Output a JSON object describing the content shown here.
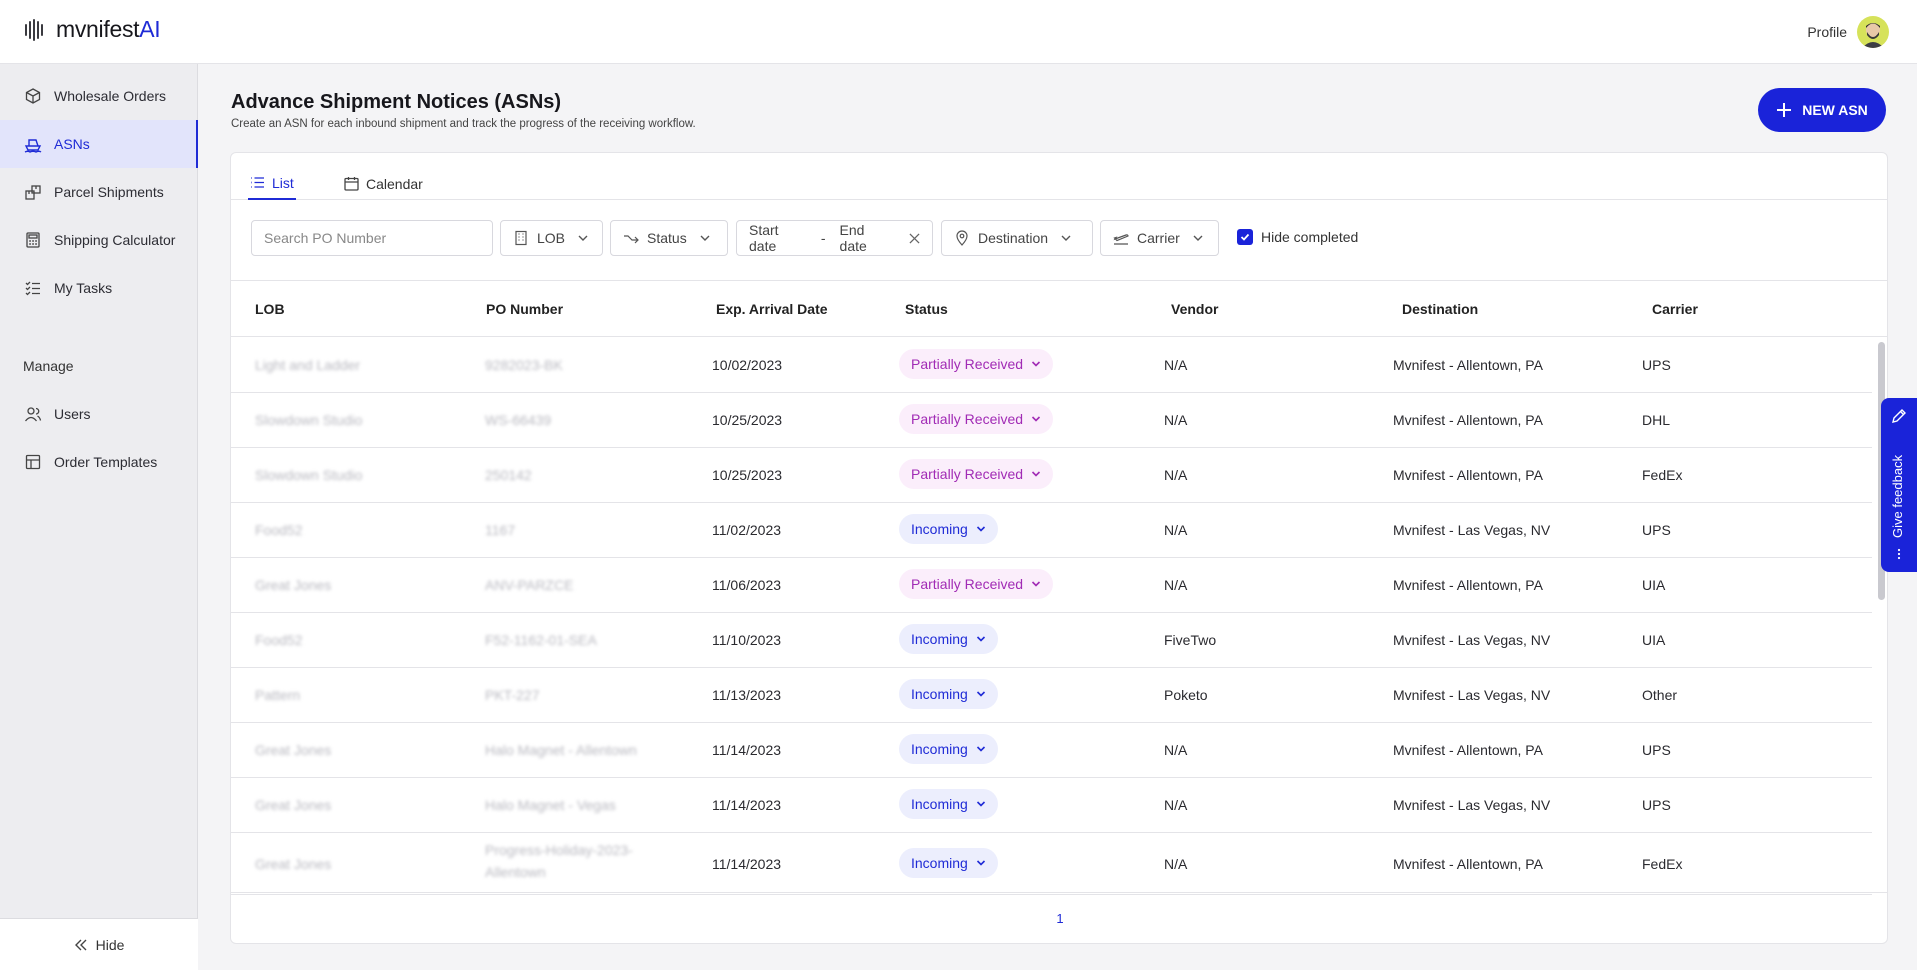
{
  "app": {
    "logo_main": "mvnifest",
    "logo_ai": "AI",
    "profile_label": "Profile"
  },
  "sidebar": {
    "items": [
      {
        "label": "Wholesale Orders",
        "icon": "box-icon"
      },
      {
        "label": "ASNs",
        "icon": "ship-icon",
        "active": true
      },
      {
        "label": "Parcel Shipments",
        "icon": "parcel-icon"
      },
      {
        "label": "Shipping Calculator",
        "icon": "calculator-icon"
      },
      {
        "label": "My Tasks",
        "icon": "tasks-icon"
      }
    ],
    "manage_label": "Manage",
    "manage_items": [
      {
        "label": "Users",
        "icon": "users-icon"
      },
      {
        "label": "Order Templates",
        "icon": "template-icon"
      }
    ],
    "hide_label": "Hide"
  },
  "header": {
    "title": "Advance Shipment Notices (ASNs)",
    "subtitle": "Create an ASN for each inbound shipment and track the progress of the receiving workflow.",
    "new_button": "NEW ASN"
  },
  "tabs": [
    {
      "label": "List",
      "active": true
    },
    {
      "label": "Calendar"
    }
  ],
  "filters": {
    "search_placeholder": "Search PO Number",
    "lob": "LOB",
    "status": "Status",
    "start_date": "Start date",
    "date_separator": "-",
    "end_date": "End date",
    "destination": "Destination",
    "carrier": "Carrier",
    "hide_completed": "Hide completed",
    "hide_completed_checked": true
  },
  "table": {
    "columns": [
      "LOB",
      "PO Number",
      "Exp. Arrival Date",
      "Status",
      "Vendor",
      "Destination",
      "Carrier"
    ],
    "rows": [
      {
        "lob": "Light and Ladder",
        "po": "9282023-BK",
        "date": "10/02/2023",
        "status": "Partially Received",
        "vendor": "N/A",
        "destination": "Mvnifest - Allentown, PA",
        "carrier": "UPS"
      },
      {
        "lob": "Slowdown Studio",
        "po": "WS-66439",
        "date": "10/25/2023",
        "status": "Partially Received",
        "vendor": "N/A",
        "destination": "Mvnifest - Allentown, PA",
        "carrier": "DHL"
      },
      {
        "lob": "Slowdown Studio",
        "po": "250142",
        "date": "10/25/2023",
        "status": "Partially Received",
        "vendor": "N/A",
        "destination": "Mvnifest - Allentown, PA",
        "carrier": "FedEx"
      },
      {
        "lob": "Food52",
        "po": "1167",
        "date": "11/02/2023",
        "status": "Incoming",
        "vendor": "N/A",
        "destination": "Mvnifest - Las Vegas, NV",
        "carrier": "UPS"
      },
      {
        "lob": "Great Jones",
        "po": "ANV-PARZCE",
        "date": "11/06/2023",
        "status": "Partially Received",
        "vendor": "N/A",
        "destination": "Mvnifest - Allentown, PA",
        "carrier": "UIA"
      },
      {
        "lob": "Food52",
        "po": "F52-1162-01-SEA",
        "date": "11/10/2023",
        "status": "Incoming",
        "vendor": "FiveTwo",
        "destination": "Mvnifest - Las Vegas, NV",
        "carrier": "UIA"
      },
      {
        "lob": "Pattern",
        "po": "PKT-227",
        "date": "11/13/2023",
        "status": "Incoming",
        "vendor": "Poketo",
        "destination": "Mvnifest - Las Vegas, NV",
        "carrier": "Other"
      },
      {
        "lob": "Great Jones",
        "po": "Halo Magnet - Allentown",
        "date": "11/14/2023",
        "status": "Incoming",
        "vendor": "N/A",
        "destination": "Mvnifest - Allentown, PA",
        "carrier": "UPS"
      },
      {
        "lob": "Great Jones",
        "po": "Halo Magnet - Vegas",
        "date": "11/14/2023",
        "status": "Incoming",
        "vendor": "N/A",
        "destination": "Mvnifest - Las Vegas, NV",
        "carrier": "UPS"
      },
      {
        "lob": "Great Jones",
        "po": "Progress-Holiday-2023-Allentown",
        "date": "11/14/2023",
        "status": "Incoming",
        "vendor": "N/A",
        "destination": "Mvnifest - Allentown, PA",
        "carrier": "FedEx"
      }
    ]
  },
  "pagination": {
    "current_page": "1"
  },
  "feedback": {
    "label": "Give feedback"
  },
  "colors": {
    "accent": "#1a23d9",
    "partial_text": "#a12bb5",
    "partial_bg": "#fbeefb",
    "incoming_bg": "#eceefd"
  }
}
